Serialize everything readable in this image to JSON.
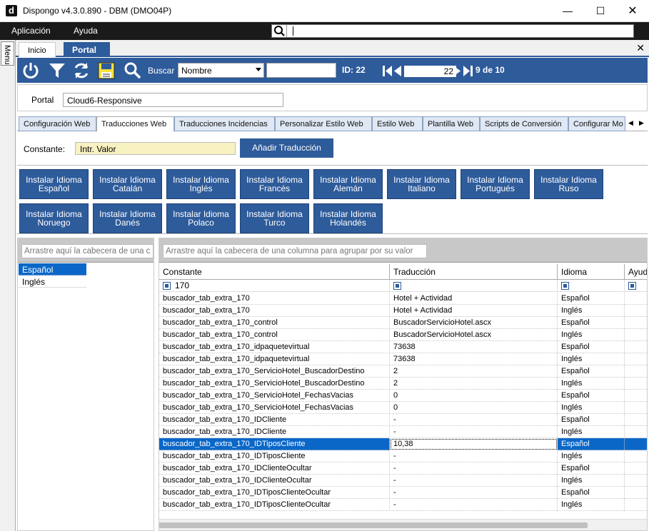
{
  "window": {
    "title": "Dispongo v4.3.0.890 - DBM (DMO04P)",
    "icon_letter": "d"
  },
  "menubar": {
    "items": [
      "Aplicación",
      "Ayuda"
    ],
    "search_value": ""
  },
  "side_menu": {
    "label": "Menu"
  },
  "doc_tabs": [
    {
      "label": "Inicio"
    },
    {
      "label": "Portal"
    }
  ],
  "toolbar": {
    "search_label": "Buscar",
    "search_field": "Nombre",
    "search_value": "",
    "id_label": "ID: 22",
    "current_page": "22",
    "page_count": "9 de 10"
  },
  "portal": {
    "label": "Portal",
    "value": "Cloud6-Responsive"
  },
  "sub_tabs": [
    "Configuración Web",
    "Traducciones Web",
    "Traducciones Incidencias",
    "Personalizar Estilo Web",
    "Estilo Web",
    "Plantilla Web",
    "Scripts de Conversión",
    "Configurar Mo"
  ],
  "constante": {
    "label": "Constante:",
    "value": "Intr. Valor",
    "add_button": "Añadir Traducción"
  },
  "install_buttons": [
    {
      "line1": "Instalar Idioma",
      "line2": "Español"
    },
    {
      "line1": "Instalar Idioma",
      "line2": "Catalán"
    },
    {
      "line1": "Instalar Idioma",
      "line2": "Inglés"
    },
    {
      "line1": "Instalar Idioma",
      "line2": "Francés"
    },
    {
      "line1": "Instalar Idioma",
      "line2": "Alemán"
    },
    {
      "line1": "Instalar Idioma",
      "line2": "Italiano"
    },
    {
      "line1": "Instalar Idioma",
      "line2": "Portugués"
    },
    {
      "line1": "Instalar Idioma",
      "line2": "Ruso"
    },
    {
      "line1": "Instalar Idioma",
      "line2": "Noruego"
    },
    {
      "line1": "Instalar Idioma",
      "line2": "Danés"
    },
    {
      "line1": "Instalar Idioma",
      "line2": "Polaco"
    },
    {
      "line1": "Instalar Idioma",
      "line2": "Turco"
    },
    {
      "line1": "Instalar Idioma",
      "line2": "Holandés"
    }
  ],
  "left_panel": {
    "group_placeholder": "Arrastre aquí la cabecera de una c",
    "languages": [
      "Español",
      "Inglés"
    ]
  },
  "grid": {
    "group_placeholder": "Arrastre aquí la cabecera de una columna para agrupar por su valor",
    "columns": [
      "Constante",
      "Traducción",
      "Idioma",
      "Ayuda"
    ],
    "filter_value": "170",
    "rows": [
      [
        "buscador_tab_extra_170",
        "Hotel + Actividad",
        "Español"
      ],
      [
        "buscador_tab_extra_170",
        "Hotel + Actividad",
        "Inglés"
      ],
      [
        "buscador_tab_extra_170_control",
        "BuscadorServicioHotel.ascx",
        "Español"
      ],
      [
        "buscador_tab_extra_170_control",
        "BuscadorServicioHotel.ascx",
        "Inglés"
      ],
      [
        "buscador_tab_extra_170_idpaquetevirtual",
        "73638",
        "Español"
      ],
      [
        "buscador_tab_extra_170_idpaquetevirtual",
        "73638",
        "Inglés"
      ],
      [
        "buscador_tab_extra_170_ServicioHotel_BuscadorDestino",
        "2",
        "Español"
      ],
      [
        "buscador_tab_extra_170_ServicioHotel_BuscadorDestino",
        "2",
        "Inglés"
      ],
      [
        "buscador_tab_extra_170_ServicioHotel_FechasVacias",
        "0",
        "Español"
      ],
      [
        "buscador_tab_extra_170_ServicioHotel_FechasVacias",
        "0",
        "Inglés"
      ],
      [
        "buscador_tab_extra_170_IDCliente",
        "-",
        "Español"
      ],
      [
        "buscador_tab_extra_170_IDCliente",
        "-",
        "Inglés"
      ],
      [
        "buscador_tab_extra_170_IDTiposCliente",
        "10,38",
        "Español"
      ],
      [
        "buscador_tab_extra_170_IDTiposCliente",
        "-",
        "Inglés"
      ],
      [
        "buscador_tab_extra_170_IDClienteOcultar",
        "-",
        "Español"
      ],
      [
        "buscador_tab_extra_170_IDClienteOcultar",
        "-",
        "Inglés"
      ],
      [
        "buscador_tab_extra_170_IDTiposClienteOcultar",
        "-",
        "Español"
      ],
      [
        "buscador_tab_extra_170_IDTiposClienteOcultar",
        "-",
        "Inglés"
      ]
    ],
    "selected_row": 12
  },
  "colors": {
    "accent": "#2e5b9a",
    "selection": "#0a67c8",
    "highlight_input": "#f8f2c2"
  }
}
